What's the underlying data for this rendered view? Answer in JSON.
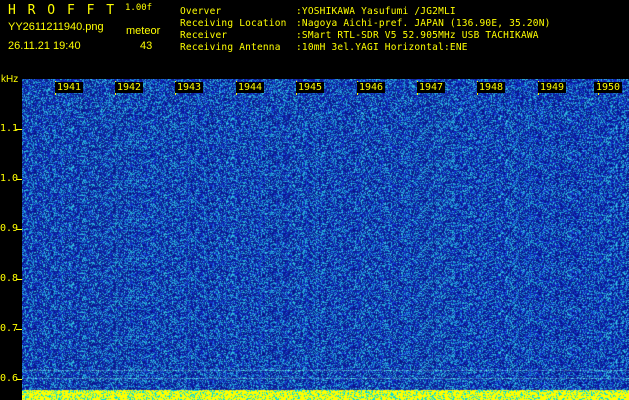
{
  "app": {
    "logo": "H R O F F T",
    "version": "1.00f",
    "filename": "YY2611211940.png",
    "datetime": "26.11.21 19:40",
    "meteor_label": "meteor",
    "meteor_count": "43"
  },
  "station": [
    {
      "key": "Overver",
      "value": ":YOSHIKAWA Yasufumi /JG2MLI"
    },
    {
      "key": "Receiving Location",
      "value": ":Nagoya Aichi-pref. JAPAN (136.90E, 35.20N)"
    },
    {
      "key": "Receiver",
      "value": ":SMart RTL-SDR V5 52.905MHz USB TACHIKAWA"
    },
    {
      "key": "Receiving Antenna",
      "value": ":10mH 3el.YAGI Horizontal:ENE"
    }
  ],
  "yaxis": {
    "unit": "kHz",
    "labels": [
      "1.1",
      "1.0",
      "0.9",
      "0.8",
      "0.7",
      "0.6"
    ]
  },
  "time_labels": [
    "1941",
    "1942",
    "1943",
    "1944",
    "1945",
    "1946",
    "1947",
    "1948",
    "1949",
    "1950"
  ],
  "colors": {
    "text": "#ffff00",
    "background": "#000000",
    "noise_dark": "#0a1f9c",
    "noise_light": "#2fa8d8",
    "floor": "#ffff00"
  }
}
